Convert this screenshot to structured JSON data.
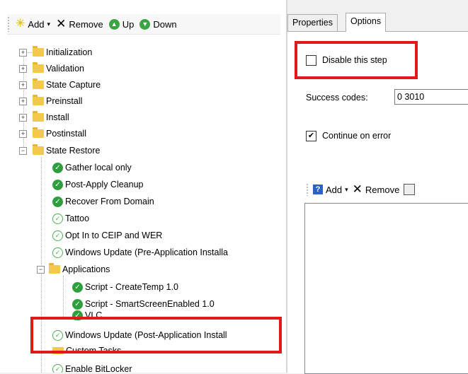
{
  "toolbar": {
    "add_label": "Add",
    "remove_label": "Remove",
    "up_label": "Up",
    "down_label": "Down"
  },
  "tree": {
    "groups": [
      {
        "label": "Initialization"
      },
      {
        "label": "Validation"
      },
      {
        "label": "State Capture"
      },
      {
        "label": "Preinstall"
      },
      {
        "label": "Install"
      },
      {
        "label": "Postinstall"
      },
      {
        "label": "State Restore"
      }
    ],
    "state_restore_items": [
      {
        "label": "Gather local only"
      },
      {
        "label": "Post-Apply Cleanup"
      },
      {
        "label": "Recover From Domain"
      },
      {
        "label": "Tattoo"
      },
      {
        "label": "Opt In to CEIP and WER"
      },
      {
        "label": "Windows Update (Pre-Application Installa"
      }
    ],
    "applications_label": "Applications",
    "app_items": [
      {
        "label": "Script - CreateTemp 1.0"
      },
      {
        "label": "Script - SmartScreenEnabled 1.0"
      },
      {
        "label": "VLC"
      }
    ],
    "post_app_update_label": "Windows Update (Post-Application Install",
    "custom_tasks_label": "Custom Tasks",
    "enable_bitlocker_label": "Enable BitLocker"
  },
  "tabs": {
    "properties": "Properties",
    "options": "Options"
  },
  "options": {
    "disable_label": "Disable this step",
    "disable_checked": false,
    "success_codes_label": "Success codes:",
    "success_codes_value": "0 3010",
    "continue_label": "Continue on error",
    "continue_checked": true,
    "cond_add_label": "Add",
    "cond_remove_label": "Remove"
  },
  "colors": {
    "highlight_red": "#e1191b",
    "success_green": "#2f9e3f"
  }
}
